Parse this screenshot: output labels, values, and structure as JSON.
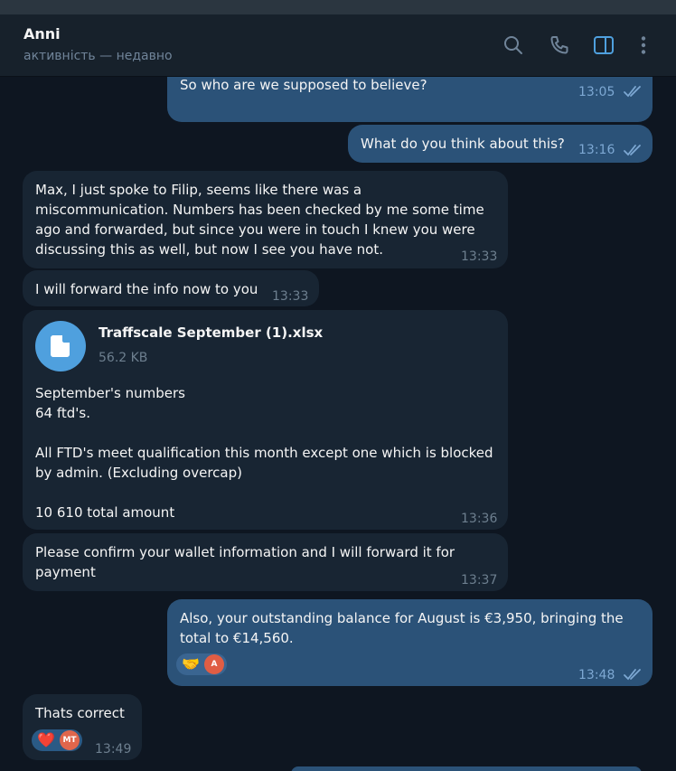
{
  "header": {
    "contact_name": "Anni",
    "status": "активність — недавно",
    "icons": [
      "search-icon",
      "phone-icon",
      "sidebar-toggle-icon",
      "more-vertical-icon"
    ],
    "accent": "#4fa0de"
  },
  "messages": [
    {
      "id": "m1",
      "direction": "out",
      "text": "So who are we supposed to believe?",
      "time": "13:05",
      "read": true
    },
    {
      "id": "m2",
      "direction": "out",
      "text": "What do you think about this?",
      "time": "13:16",
      "read": true
    },
    {
      "id": "m3",
      "direction": "in",
      "text": "Max, I just spoke to Filip, seems like there was a\nmiscommunication. Numbers has been checked by me some time\nago and forwarded, but since you were in touch I knew you were\ndiscussing this as well, but now I see you have not.",
      "time": "13:33"
    },
    {
      "id": "m4",
      "direction": "in",
      "text": "I will forward the info now to you",
      "time": "13:33"
    },
    {
      "id": "m5",
      "direction": "in",
      "file": {
        "name": "Traffscale September (1).xlsx",
        "size": "56.2 KB",
        "icon": "file-icon"
      },
      "text": "September's numbers\n64 ftd's.\n\nAll FTD's meet qualification this month except one which is blocked\nby admin. (Excluding overcap)\n\n10 610 total amount",
      "time": "13:36"
    },
    {
      "id": "m6",
      "direction": "in",
      "text": "Please confirm your wallet information and I will forward it for\npayment",
      "time": "13:37"
    },
    {
      "id": "m7",
      "direction": "out",
      "text": "Also, your outstanding balance for August is €3,950, bringing the\ntotal to €14,560.",
      "time": "13:48",
      "read": true,
      "reaction": {
        "emoji": "🤝",
        "avatar": "A",
        "avatar_color": "#e05d44"
      }
    },
    {
      "id": "m8",
      "direction": "in",
      "text": "Thats correct",
      "time": "13:49",
      "reaction": {
        "emoji": "❤️",
        "avatar": "MT",
        "avatar_color": "#e0664c"
      }
    }
  ]
}
